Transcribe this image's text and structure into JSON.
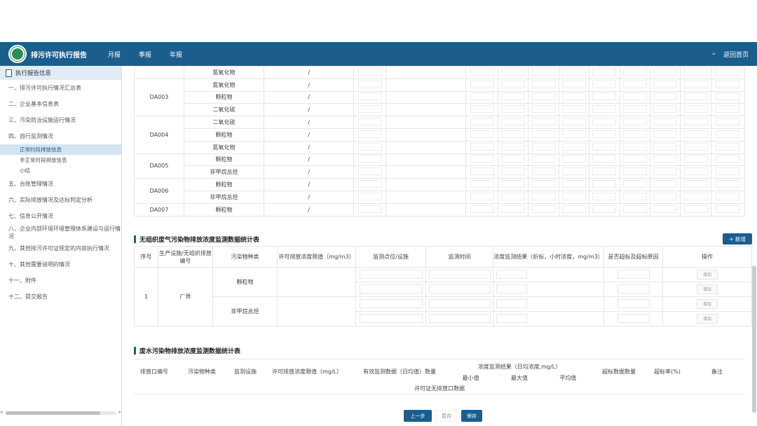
{
  "nav": {
    "title": "排污许可执行报告",
    "tabs": [
      "月报",
      "季报",
      "年报"
    ],
    "dropdown": "⌄",
    "back": "返回首页"
  },
  "sidebar": {
    "header": "执行报告信息",
    "items": [
      {
        "label": "一、排污许可执行情况汇总表",
        "type": "item"
      },
      {
        "label": "二、企业基本信息表",
        "type": "item"
      },
      {
        "label": "三、污染防治设施运行情况",
        "type": "item"
      },
      {
        "label": "四、自行监测情况",
        "type": "item"
      },
      {
        "label": "正常时段排放信息",
        "type": "sub",
        "active": true
      },
      {
        "label": "非正常时段排放信息",
        "type": "sub"
      },
      {
        "label": "小结",
        "type": "sub"
      },
      {
        "label": "五、台账管理情况",
        "type": "item"
      },
      {
        "label": "六、实际排放情况及达标判定分析",
        "type": "item"
      },
      {
        "label": "七、信息公开情况",
        "type": "item"
      },
      {
        "label": "八、企业内部环境环境管理体系建设与运行情况",
        "type": "item"
      },
      {
        "label": "九、其他排污许可证规定的内容执行情况",
        "type": "item"
      },
      {
        "label": "十、其他需要说明的情况",
        "type": "item"
      },
      {
        "label": "十一、附件",
        "type": "item"
      },
      {
        "label": "十二、提交报告",
        "type": "item"
      }
    ]
  },
  "table_top": {
    "rows": [
      {
        "outlet": "",
        "pollutant": "氮氧化物",
        "limit": "/"
      },
      {
        "outlet": "DA003",
        "span": 3,
        "pollutant": "氮氧化物",
        "limit": "/"
      },
      {
        "pollutant": "颗粒物",
        "limit": "/"
      },
      {
        "pollutant": "二氧化硫",
        "limit": "/"
      },
      {
        "outlet": "DA004",
        "span": 3,
        "pollutant": "二氧化硫",
        "limit": "/"
      },
      {
        "pollutant": "颗粒物",
        "limit": "/"
      },
      {
        "pollutant": "氮氧化物",
        "limit": "/"
      },
      {
        "outlet": "DA005",
        "span": 2,
        "pollutant": "颗粒物",
        "limit": "/"
      },
      {
        "pollutant": "非甲烷总烃",
        "limit": "/"
      },
      {
        "outlet": "DA006",
        "span": 2,
        "pollutant": "颗粒物",
        "limit": "/"
      },
      {
        "pollutant": "非甲烷总烃",
        "limit": "/"
      },
      {
        "outlet": "DA007",
        "span": 1,
        "pollutant": "颗粒物",
        "limit": "/"
      }
    ]
  },
  "section2": {
    "title": "无组织废气污染物排放浓度监测数据统计表",
    "add_button": "+ 新增",
    "headers": [
      "序号",
      "生产设施/无组织排放编号",
      "污染物种类",
      "许可排放浓度限值（mg/m3）",
      "监测点位/设施",
      "监测时间",
      "浓度监测结果（折标，小时浓度，mg/m3）",
      "是否超标及超标原因",
      "操作"
    ],
    "row_no": "1",
    "facility": "厂界",
    "pollutants": [
      "颗粒物",
      "非甲烷总烃"
    ],
    "op_label": "增加"
  },
  "section3": {
    "title": "废水污染物排放浓度监测数据统计表",
    "headers": [
      "排放口编号",
      "污染物种类",
      "监测设施",
      "许可排放浓度限值（mg/L）",
      "有效监测数据（日均值）数量",
      "浓度监测结果（日均浓度,mg/L）",
      "超标数据数量",
      "超标率(%)",
      "备注"
    ],
    "sub_headers": [
      "最小值",
      "最大值",
      "平均值"
    ],
    "empty_text": "许可证无排放口数据"
  },
  "buttons": {
    "prev": "上一步",
    "temp": "暂存",
    "save": "保存"
  }
}
